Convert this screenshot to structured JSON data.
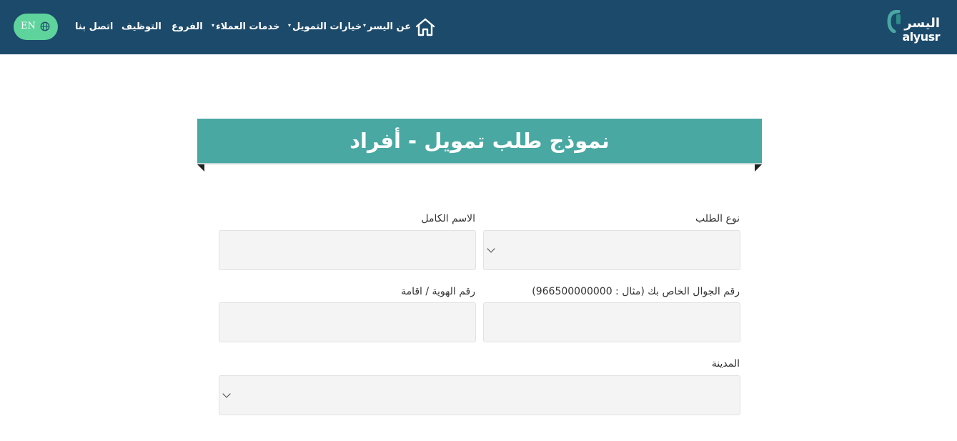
{
  "header": {
    "logo_ar": "اليسر",
    "logo_en": "alyusr",
    "nav": {
      "about": "عن اليسر",
      "financing": "خيارات التمويل",
      "customer_services": "خدمات العملاء",
      "branches": "الفروع",
      "careers": "التوظيف",
      "contact": "اتصل بنا"
    },
    "lang_label": "EN"
  },
  "banner": {
    "title": "نموذج طلب تمويل - أفراد"
  },
  "form": {
    "request_type_label": "نوع الطلب",
    "full_name_label": "الاسم الكامل",
    "mobile_label": "رقم الجوال الخاص بك (مثال : 966500000000)",
    "id_label": "رقم الهوية / اقامة",
    "city_label": "المدينة"
  },
  "colors": {
    "header_bg": "#1c4a6b",
    "banner_bg": "#4aa8a3",
    "lang_button": "#5fd39c",
    "field_bg": "#f4f4f4"
  }
}
